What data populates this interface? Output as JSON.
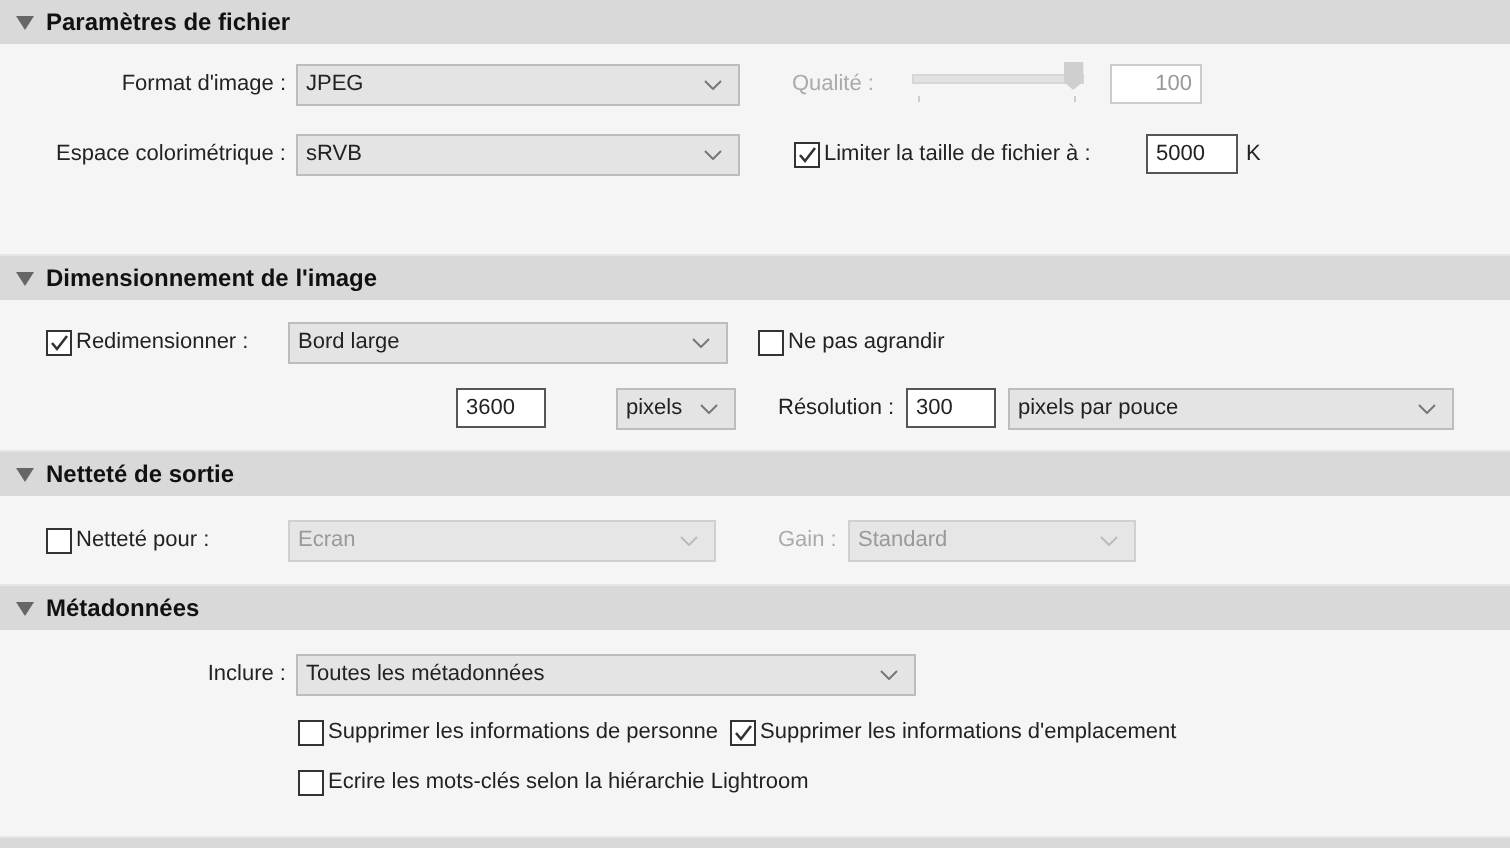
{
  "file_settings": {
    "title": "Paramètres de fichier",
    "expanded": true,
    "image_format": {
      "label": "Format d'image :",
      "value": "JPEG"
    },
    "color_space": {
      "label": "Espace colorimétrique :",
      "value": "sRVB"
    },
    "quality": {
      "label": "Qualité :",
      "disabled": true,
      "level": 0.96,
      "value": "100"
    },
    "limit_size": {
      "label": "Limiter la taille de fichier à :",
      "checked": true,
      "value": "5000",
      "unit": "K"
    }
  },
  "image_sizing": {
    "title": "Dimensionnement de l'image",
    "expanded": true,
    "resize": {
      "label": "Redimensionner :",
      "checked": true,
      "value": "Bord large"
    },
    "dont_enlarge": {
      "label": "Ne pas agrandir",
      "checked": false
    },
    "size": {
      "value": "3600",
      "unit": "pixels"
    },
    "resolution": {
      "label": "Résolution :",
      "value": "300",
      "unit": "pixels par pouce"
    }
  },
  "output_sharpening": {
    "title": "Netteté de sortie",
    "expanded": true,
    "sharpen_for": {
      "label": "Netteté pour :",
      "checked": false,
      "value": "Ecran",
      "disabled": true
    },
    "amount": {
      "label": "Gain :",
      "value": "Standard",
      "disabled": true
    }
  },
  "metadata": {
    "title": "Métadonnées",
    "expanded": true,
    "include": {
      "label": "Inclure :",
      "value": "Toutes les métadonnées"
    },
    "options": [
      {
        "label": "Supprimer les informations de personne",
        "checked": false
      },
      {
        "label": "Supprimer les informations d'emplacement",
        "checked": true
      },
      {
        "label": "Ecrire les mots-clés selon la hiérarchie Lightroom",
        "checked": false
      }
    ]
  }
}
